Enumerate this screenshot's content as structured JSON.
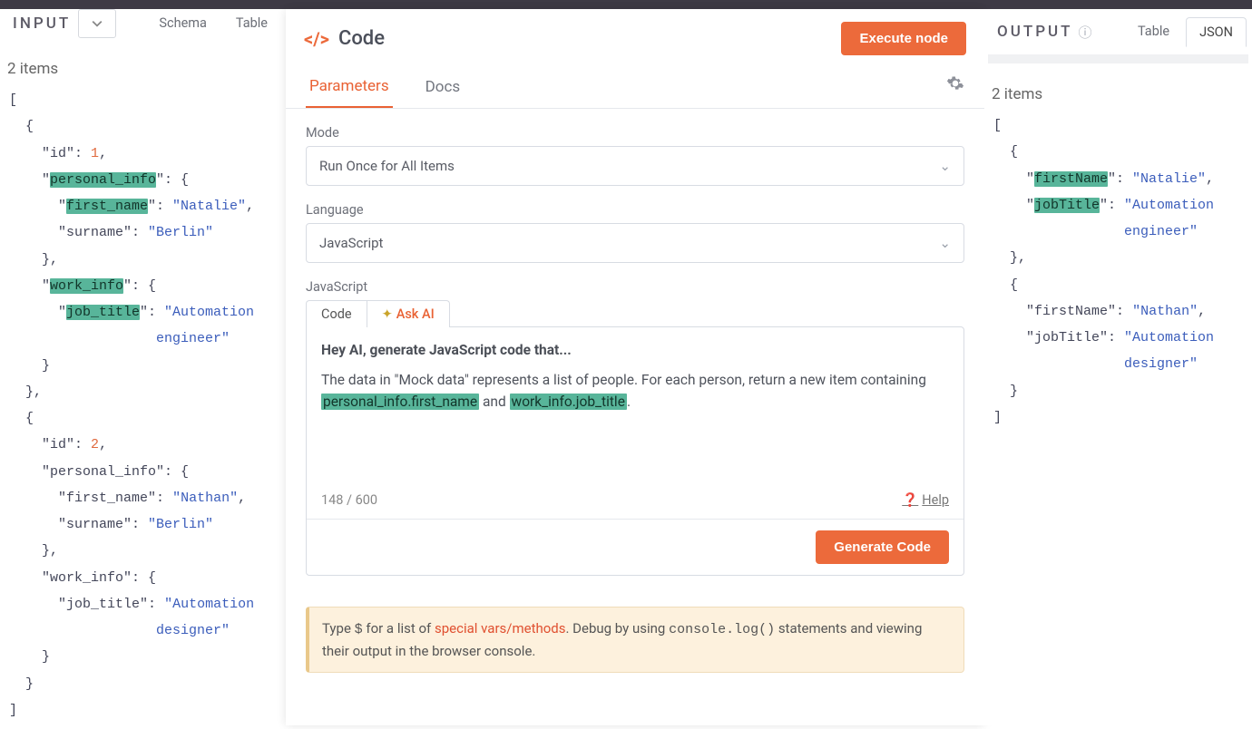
{
  "input": {
    "title": "INPUT",
    "tabs": {
      "schema": "Schema",
      "table": "Table"
    },
    "items_label": "2 items",
    "data": [
      {
        "id": 1,
        "personal_info": {
          "first_name": "Natalie",
          "surname": "Berlin"
        },
        "work_info": {
          "job_title": "Automation engineer"
        }
      },
      {
        "id": 2,
        "personal_info": {
          "first_name": "Nathan",
          "surname": "Berlin"
        },
        "work_info": {
          "job_title": "Automation designer"
        }
      }
    ]
  },
  "center": {
    "title": "Code",
    "execute_label": "Execute node",
    "tabs": {
      "parameters": "Parameters",
      "docs": "Docs"
    },
    "mode": {
      "label": "Mode",
      "value": "Run Once for All Items"
    },
    "language": {
      "label": "Language",
      "value": "JavaScript"
    },
    "js_section_label": "JavaScript",
    "code_tab": "Code",
    "askai_tab": "Ask AI",
    "ai_head": "Hey AI, generate JavaScript code that...",
    "ai_body_pre": "The data in \"Mock data\" represents a list of people. For each person, return a new item containing ",
    "ai_hl1": "personal_info.first_name",
    "ai_mid": " and ",
    "ai_hl2": "work_info.job_title",
    "ai_post": ".",
    "counter": "148 / 600",
    "help": "Help",
    "generate": "Generate Code",
    "hint_pre": "Type ",
    "hint_dollar": "$",
    "hint_mid1": " for a list of ",
    "hint_sv": "special vars/methods",
    "hint_mid2": ". Debug by using ",
    "hint_code": "console.log()",
    "hint_post": " statements and viewing their output in the browser console."
  },
  "output": {
    "title": "OUTPUT",
    "tabs": {
      "table": "Table",
      "json": "JSON"
    },
    "items_label": "2 items",
    "data": [
      {
        "firstName": "Natalie",
        "jobTitle": "Automation engineer"
      },
      {
        "firstName": "Nathan",
        "jobTitle": "Automation designer"
      }
    ]
  }
}
